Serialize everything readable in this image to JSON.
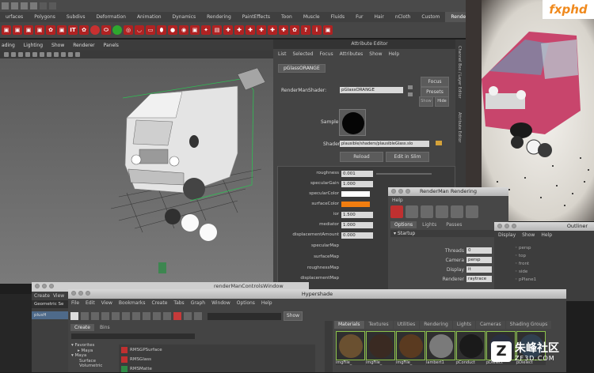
{
  "maya": {
    "shelf_tabs": [
      "urfaces",
      "Polygons",
      "Subdivs",
      "Deformation",
      "Animation",
      "Dynamics",
      "Rendering",
      "PaintEffects",
      "Toon",
      "Muscle",
      "Fluids",
      "Fur",
      "Hair",
      "nCloth",
      "Custom",
      "RenderMan"
    ],
    "active_tab_index": 15,
    "shelf_text_icon": "IT",
    "viewport_menu": [
      "ading",
      "Lighting",
      "Show",
      "Renderer",
      "Panels"
    ]
  },
  "attribute_editor": {
    "title": "Attribute Editor",
    "menu": [
      "List",
      "Selected",
      "Focus",
      "Attributes",
      "Show",
      "Help"
    ],
    "node_tab": "pGlassORANGE",
    "shader_label": "RenderManShader:",
    "shader_value": "pGlassORANGE",
    "focus_btn": "Focus",
    "presets_btn": "Presets",
    "show_btn": "Show",
    "hide_btn": "Hide",
    "sample_label": "Sample",
    "shader_path_label": "Shader",
    "shader_path": "plausible/shaders/plausibleGlass.slo",
    "reload_btn": "Reload",
    "edit_btn": "Edit in Slim",
    "attributes": [
      {
        "label": "roughness",
        "value": "0.001"
      },
      {
        "label": "specularGain",
        "value": "1.000"
      },
      {
        "label": "specularColor",
        "value": ""
      },
      {
        "label": "surfaceColor",
        "value": ""
      },
      {
        "label": "ior",
        "value": "1.500"
      },
      {
        "label": "mediator",
        "value": "1.000"
      },
      {
        "label": "displacementAmount",
        "value": "0.000"
      },
      {
        "label": "specularMap",
        "value": ""
      },
      {
        "label": "surfaceMap",
        "value": ""
      },
      {
        "label": "roughnessMap",
        "value": ""
      },
      {
        "label": "displacementMap",
        "value": ""
      }
    ],
    "specular_color": "#ffffff",
    "surface_color": "#f07d10"
  },
  "side_panels": {
    "channel_box": "Channel Box / Layer Editor",
    "attribute_editor_vert": "Attribute Editor"
  },
  "renderman_rendering": {
    "title": "RenderMan Rendering",
    "menu": "Help",
    "tabs": [
      "Options",
      "Lights",
      "Passes"
    ],
    "section": "Startup",
    "fields": [
      {
        "label": "Threads",
        "value": "0"
      },
      {
        "label": "Camera",
        "value": "persp"
      },
      {
        "label": "Display",
        "value": "it"
      },
      {
        "label": "Renderer",
        "value": "raytrace"
      }
    ]
  },
  "outliner": {
    "title": "Outliner",
    "menu": [
      "Display",
      "Show",
      "Help"
    ],
    "items": [
      "persp",
      "top",
      "front",
      "side",
      "pPlane1"
    ]
  },
  "render_controls_window": {
    "title": "renderManControlsWindow",
    "menu": [
      "Create",
      "View"
    ],
    "row1": "Geometric Se",
    "row2": "plusH"
  },
  "hypershade": {
    "title": "Hypershade",
    "menu": [
      "File",
      "Edit",
      "View",
      "Bookmarks",
      "Create",
      "Tabs",
      "Graph",
      "Window",
      "Options",
      "Help"
    ],
    "show_btn": "Show",
    "left_tabs": [
      "Create",
      "Bins"
    ],
    "tree": [
      "Favorites",
      "Maya",
      "Maya",
      "Surface",
      "Volumetric"
    ],
    "materials_list": [
      "RMSGPSurface",
      "RMSGlass",
      "RMSMatte"
    ],
    "right_tabs": [
      "Materials",
      "Textures",
      "Utilities",
      "Rendering",
      "Lights",
      "Cameras",
      "Shading Groups"
    ],
    "swatches": [
      {
        "label": "imgFile_",
        "color": "#6a5030"
      },
      {
        "label": "imgFile_",
        "color": "#3a2a22"
      },
      {
        "label": "imgFile_",
        "color": "#5a3a20"
      },
      {
        "label": "lambert1",
        "color": "#7a7a7a"
      },
      {
        "label": "pConduct",
        "color": "#1a1a1a"
      },
      {
        "label": "pDielect",
        "color": "#2a3040"
      },
      {
        "label": "pDielect",
        "color": "#304050"
      }
    ]
  },
  "watermarks": {
    "fxphd": "fxphd",
    "zf3d_cn": "朱峰社区",
    "zf3d_url": "ZF3D.COM"
  }
}
